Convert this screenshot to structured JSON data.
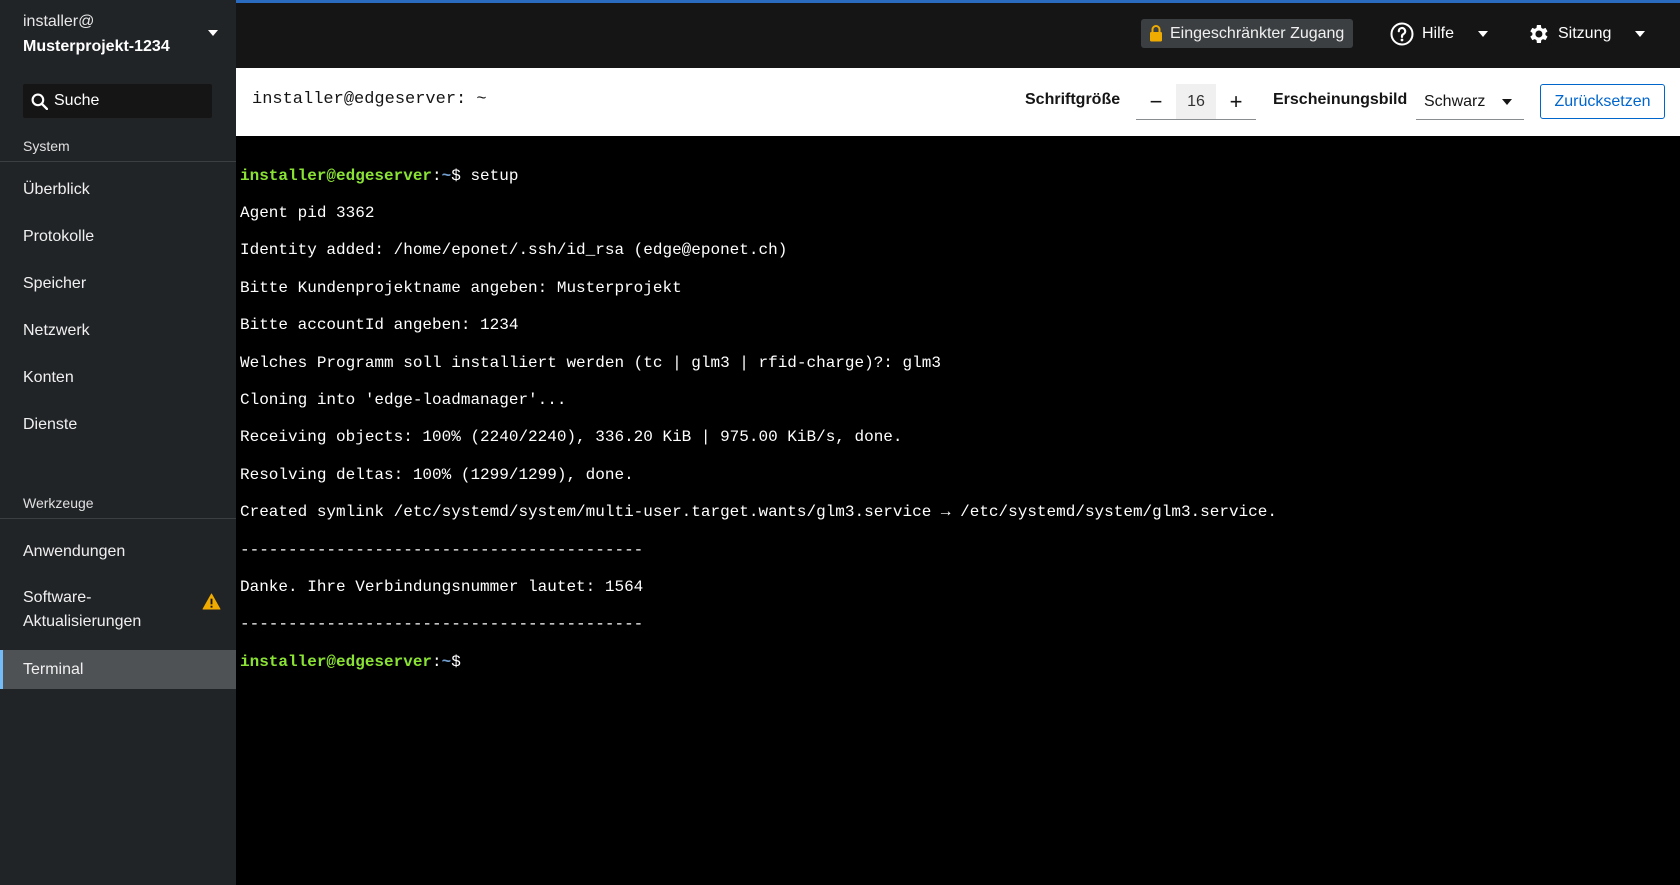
{
  "host": {
    "user": "installer@",
    "name": "Musterprojekt-1234"
  },
  "search": {
    "placeholder": "Suche"
  },
  "sidebar": {
    "section_system": "System",
    "section_tools": "Werkzeuge",
    "items": [
      {
        "label": "Überblick"
      },
      {
        "label": "Protokolle"
      },
      {
        "label": "Speicher"
      },
      {
        "label": "Netzwerk"
      },
      {
        "label": "Konten"
      },
      {
        "label": "Dienste"
      }
    ],
    "tool_items": [
      {
        "label": "Anwendungen"
      },
      {
        "label": "Software-\nAktualisierungen",
        "badge_icon": "warning-icon"
      },
      {
        "label": "Terminal",
        "active": true
      }
    ]
  },
  "masthead": {
    "limited_access": "Eingeschränkter Zugang",
    "help": "Hilfe",
    "session": "Sitzung",
    "accent_color": "#2b6bbf"
  },
  "toolbar": {
    "title": "installer@edgeserver: ~",
    "font_size_label": "Schriftgröße",
    "font_size_value": "16",
    "decrease": "−",
    "increase": "+",
    "appearance_label": "Erscheinungsbild",
    "appearance_value": "Schwarz",
    "reset_label": "Zurücksetzen"
  },
  "terminal": {
    "prompt_user": "installer@edgeserver",
    "prompt_sep": ":",
    "prompt_path": "~",
    "prompt_end": "$ ",
    "command": "setup",
    "lines": [
      "Agent pid 3362",
      "Identity added: /home/eponet/.ssh/id_rsa (edge@eponet.ch)",
      "Bitte Kundenprojektname angeben: Musterprojekt",
      "Bitte accountId angeben: 1234",
      "Welches Programm soll installiert werden (tc | glm3 | rfid-charge)?: glm3",
      "Cloning into 'edge-loadmanager'...",
      "Receiving objects: 100% (2240/2240), 336.20 KiB | 975.00 KiB/s, done.",
      "Resolving deltas: 100% (1299/1299), done.",
      "Created symlink /etc/systemd/system/multi-user.target.wants/glm3.service → /etc/systemd/system/glm3.service.",
      "------------------------------------------",
      "Danke. Ihre Verbindungsnummer lautet: 1564",
      "------------------------------------------"
    ],
    "prompt_color": "#8ae234",
    "path_color": "#729fcf"
  }
}
